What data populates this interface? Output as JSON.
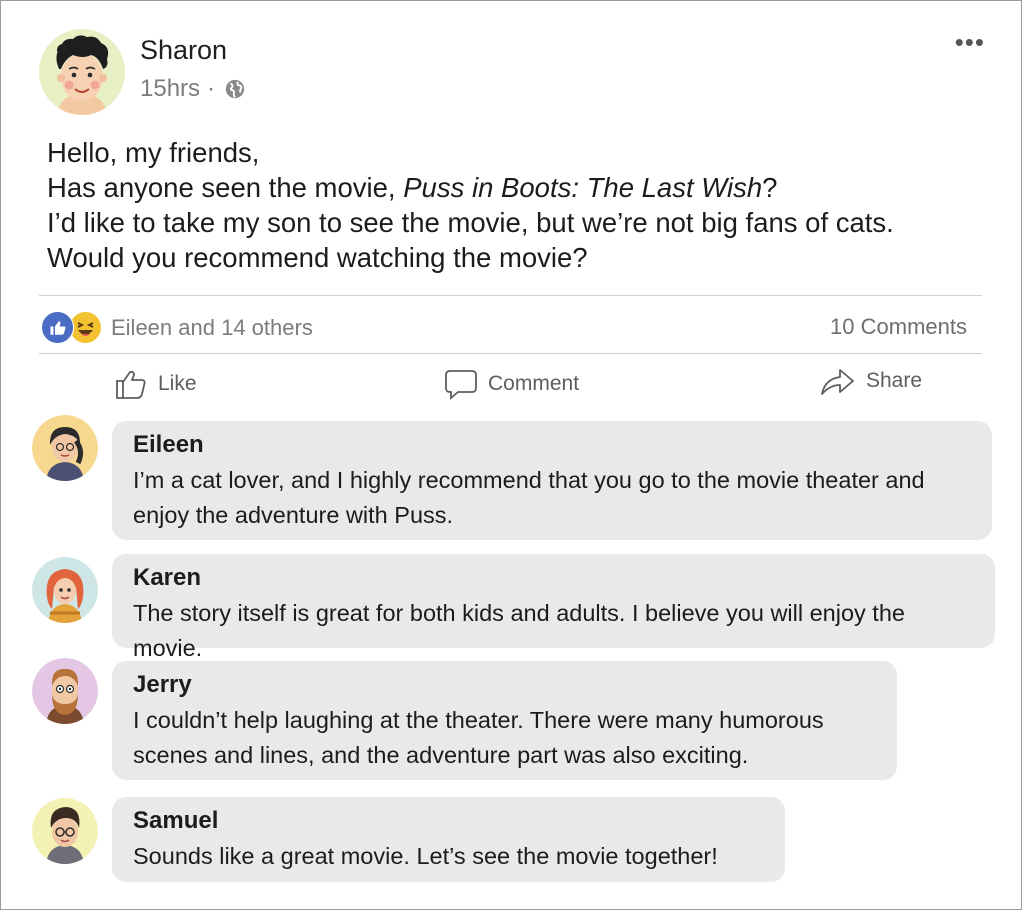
{
  "post": {
    "author": "Sharon",
    "time": "15hrs",
    "separator": "·",
    "more_label": "•••",
    "body": {
      "line1": "Hello, my friends,",
      "line2_pre": "Has anyone seen the movie, ",
      "line2_title": "Puss in Boots: The Last Wish",
      "line2_post": "?",
      "line3": "I’d like to take my son to see the movie, but we’re not big fans of cats.",
      "line4": "Would you recommend watching the movie?"
    }
  },
  "reactions": {
    "icons": [
      "like-icon",
      "haha-icon"
    ],
    "summary": "Eileen and 14 others",
    "comments_count": "10 Comments"
  },
  "actions": {
    "like": "Like",
    "comment": "Comment",
    "share": "Share"
  },
  "comments": [
    {
      "name": "Eileen",
      "text": "I’m a cat lover, and I highly recommend that you go to the movie theater and enjoy the adventure with Puss."
    },
    {
      "name": "Karen",
      "text": "The story itself is great for both kids and adults. I believe you will enjoy the movie."
    },
    {
      "name": "Jerry",
      "text": "I couldn’t help laughing at the theater. There were many humorous scenes and lines, and the adventure part was also exciting."
    },
    {
      "name": "Samuel",
      "text": "Sounds like a great movie. Let’s see the movie together!"
    }
  ],
  "colors": {
    "like_blue": "#4a6cc4",
    "haha_yellow": "#f2c230",
    "bubble_gray": "#e9e9e9",
    "muted_text": "#7c7c7c"
  }
}
